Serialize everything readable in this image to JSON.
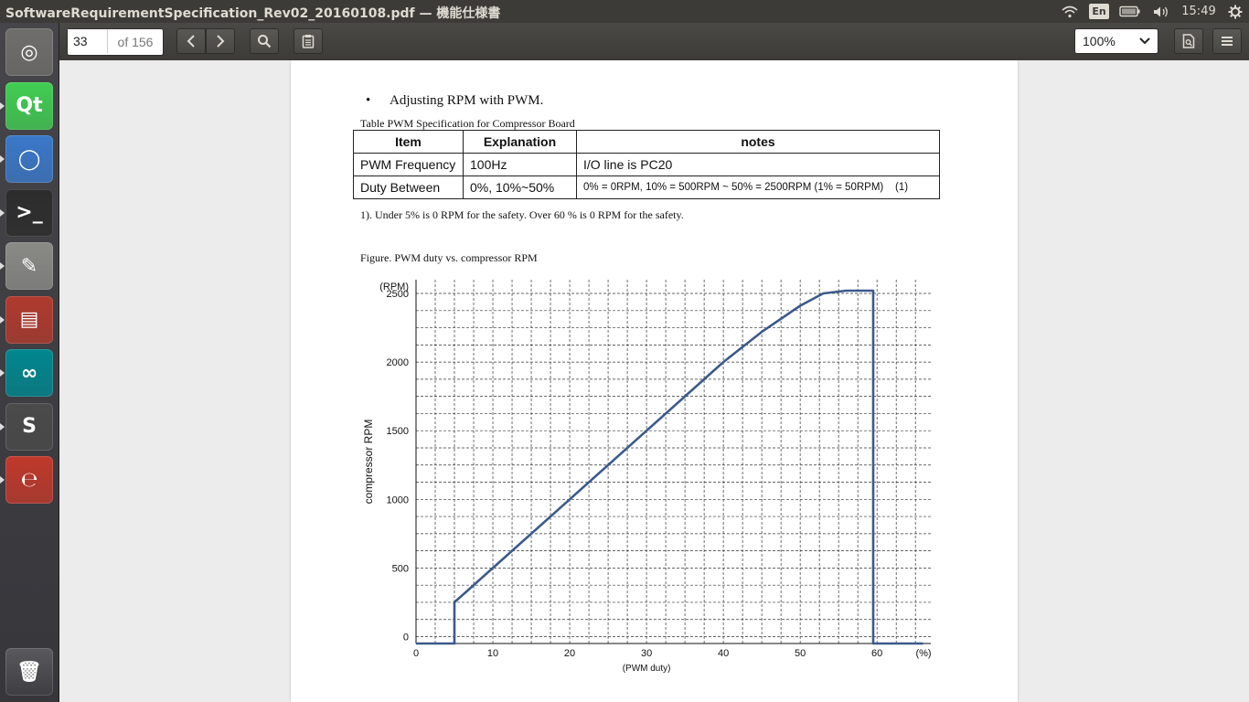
{
  "window": {
    "title": "SoftwareRequirementSpecification_Rev02_20160108.pdf — 機能仕様書"
  },
  "panel": {
    "keyboard": "En",
    "time": "15:49"
  },
  "launcher": {
    "items": [
      {
        "name": "ubuntu-dash-icon",
        "glyph": "◎",
        "color": "#6f6e6b"
      },
      {
        "name": "qt-creator-icon",
        "glyph": "Qt",
        "color": "#41cd52"
      },
      {
        "name": "chromium-icon",
        "glyph": "◯",
        "color": "#3a78c9"
      },
      {
        "name": "terminal-icon",
        "glyph": ">_",
        "color": "#2c2c2c"
      },
      {
        "name": "text-editor-icon",
        "glyph": "✎",
        "color": "#8a8a86"
      },
      {
        "name": "file-cabinet-icon",
        "glyph": "▤",
        "color": "#b03a2e"
      },
      {
        "name": "arduino-icon",
        "glyph": "∞",
        "color": "#00878f"
      },
      {
        "name": "sublime-text-icon",
        "glyph": "S",
        "color": "#4a4a4a"
      },
      {
        "name": "document-viewer-icon",
        "glyph": "℮",
        "color": "#c0392b"
      }
    ],
    "trash": {
      "name": "trash-icon",
      "glyph": "🗑"
    }
  },
  "toolbar": {
    "page_number": "33",
    "page_total": "of 156",
    "zoom": "100%"
  },
  "document": {
    "bullet_text": "Adjusting RPM with PWM.",
    "table_caption": "Table PWM Specification for Compressor Board",
    "table": {
      "headers": [
        "Item",
        "Explanation",
        "notes"
      ],
      "rows": [
        [
          "PWM Frequency",
          "100Hz",
          "I/O line is PC20"
        ],
        [
          "Duty Between",
          "0%, 10%~50%",
          "0% = 0RPM, 10% = 500RPM ~ 50% = 2500RPM (1% = 50RPM)    (1)"
        ]
      ]
    },
    "footnote": "1). Under 5% is 0 RPM for the safety. Over 60 % is 0 RPM for the safety.",
    "figure_caption": "Figure. PWM duty vs. compressor RPM"
  },
  "chart_data": {
    "type": "line",
    "title": "",
    "xlabel": "(PWM duty)",
    "ylabel": "compressor RPM",
    "x_unit_label": "(%)",
    "y_unit_label": "(RPM)",
    "xlim": [
      0,
      67
    ],
    "ylim": [
      -50,
      2600
    ],
    "x_ticks": [
      0,
      10,
      20,
      30,
      40,
      50,
      60
    ],
    "y_ticks": [
      0,
      500,
      1000,
      1500,
      2000,
      2500
    ],
    "grid": true,
    "line_color": "#3a5a8c",
    "series": [
      {
        "x": [
          0,
          5,
          5,
          10,
          20,
          30,
          40,
          45,
          50,
          53,
          56,
          59.5,
          59.5,
          66
        ],
        "y": [
          -50,
          -50,
          250,
          500,
          1000,
          1500,
          2000,
          2220,
          2410,
          2500,
          2520,
          2520,
          -50,
          -50
        ]
      }
    ]
  }
}
